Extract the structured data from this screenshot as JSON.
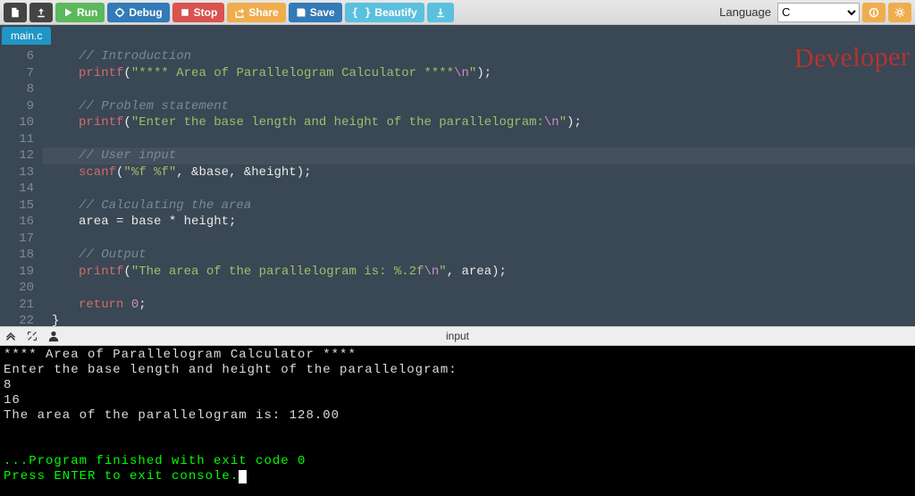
{
  "toolbar": {
    "run": "Run",
    "debug": "Debug",
    "stop": "Stop",
    "share": "Share",
    "save": "Save",
    "beautify": "Beautify",
    "language_label": "Language",
    "language_value": "C"
  },
  "tab": {
    "filename": "main.c"
  },
  "watermark": "Developer",
  "editor": {
    "first_line_no": 6,
    "highlight_line": 12,
    "lines": [
      {
        "n": 6,
        "tokens": [
          [
            "comment",
            "// Introduction"
          ]
        ]
      },
      {
        "n": 7,
        "tokens": [
          [
            "func",
            "printf"
          ],
          [
            "plain",
            "("
          ],
          [
            "string",
            "\"**** Area of Parallelogram Calculator ****"
          ],
          [
            "escape",
            "\\n"
          ],
          [
            "string",
            "\""
          ],
          [
            "plain",
            ");"
          ]
        ]
      },
      {
        "n": 8,
        "tokens": []
      },
      {
        "n": 9,
        "tokens": [
          [
            "comment",
            "// Problem statement"
          ]
        ]
      },
      {
        "n": 10,
        "tokens": [
          [
            "func",
            "printf"
          ],
          [
            "plain",
            "("
          ],
          [
            "string",
            "\"Enter the base length and height of the parallelogram:"
          ],
          [
            "escape",
            "\\n"
          ],
          [
            "string",
            "\""
          ],
          [
            "plain",
            ");"
          ]
        ]
      },
      {
        "n": 11,
        "tokens": []
      },
      {
        "n": 12,
        "tokens": [
          [
            "comment",
            "// User input"
          ]
        ]
      },
      {
        "n": 13,
        "tokens": [
          [
            "func",
            "scanf"
          ],
          [
            "plain",
            "("
          ],
          [
            "string",
            "\"%f %f\""
          ],
          [
            "plain",
            ", &"
          ],
          [
            "plain",
            "base"
          ],
          [
            "plain",
            ", &"
          ],
          [
            "plain",
            "height"
          ],
          [
            "plain",
            ");"
          ]
        ]
      },
      {
        "n": 14,
        "tokens": []
      },
      {
        "n": 15,
        "tokens": [
          [
            "comment",
            "// Calculating the area"
          ]
        ]
      },
      {
        "n": 16,
        "tokens": [
          [
            "plain",
            "area = base * height;"
          ]
        ]
      },
      {
        "n": 17,
        "tokens": []
      },
      {
        "n": 18,
        "tokens": [
          [
            "comment",
            "// Output"
          ]
        ]
      },
      {
        "n": 19,
        "tokens": [
          [
            "func",
            "printf"
          ],
          [
            "plain",
            "("
          ],
          [
            "string",
            "\"The area of the parallelogram is: %.2f"
          ],
          [
            "escape",
            "\\n"
          ],
          [
            "string",
            "\""
          ],
          [
            "plain",
            ", area);"
          ]
        ]
      },
      {
        "n": 20,
        "tokens": []
      },
      {
        "n": 21,
        "tokens": [
          [
            "keyword",
            "return"
          ],
          [
            "plain",
            " "
          ],
          [
            "num",
            "0"
          ],
          [
            "plain",
            ";"
          ]
        ]
      },
      {
        "n": 22,
        "tokens": [
          [
            "plain",
            "}"
          ]
        ],
        "dedent": true
      }
    ]
  },
  "console_header": {
    "label": "input"
  },
  "console": {
    "white_lines": [
      "**** Area of Parallelogram Calculator ****",
      "Enter the base length and height of the parallelogram:",
      "8",
      "16",
      "The area of the parallelogram is: 128.00"
    ],
    "green_lines": [
      "...Program finished with exit code 0",
      "Press ENTER to exit console."
    ]
  }
}
